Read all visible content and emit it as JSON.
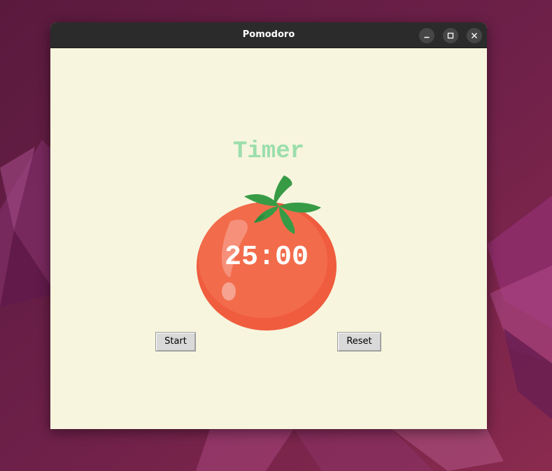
{
  "window": {
    "title": "Pomodoro",
    "controls": {
      "minimize": "minimize-icon",
      "maximize": "maximize-icon",
      "close": "close-icon"
    }
  },
  "app": {
    "heading": "Timer",
    "timer": "25:00",
    "start_label": "Start",
    "reset_label": "Reset"
  },
  "colors": {
    "background": "#f7f5dd",
    "heading": "#9bdeac",
    "tomato": "#f26849",
    "leaf": "#379b46",
    "timer_text": "#ffffff"
  }
}
